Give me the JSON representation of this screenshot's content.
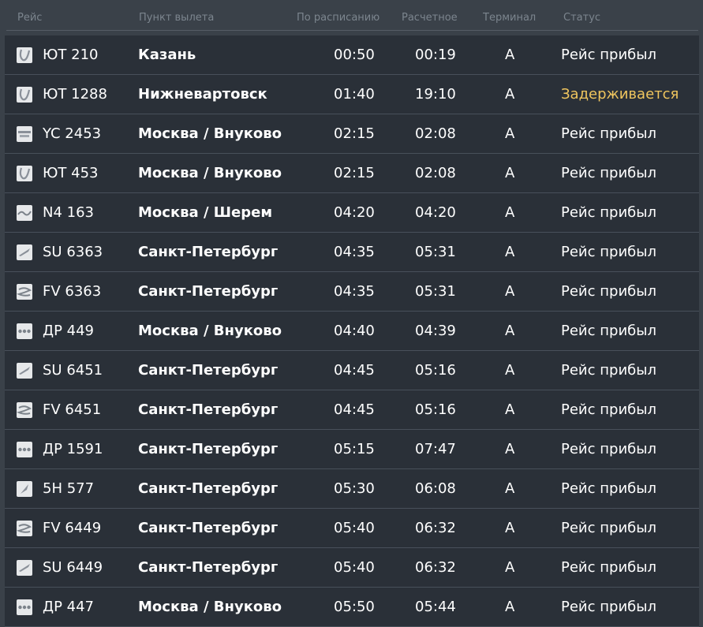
{
  "columns": {
    "flight": "Рейс",
    "origin": "Пункт вылета",
    "scheduled": "По расписанию",
    "estimated": "Расчетное",
    "terminal": "Терминал",
    "status": "Статус"
  },
  "colors": {
    "background": "#3a4149",
    "row": "#2a3038",
    "header_text": "#7c858e",
    "text": "#ffffff",
    "delayed": "#efc55e"
  },
  "flights": [
    {
      "logo": "utair-logo-icon",
      "flight": "ЮТ 210",
      "origin": "Казань",
      "scheduled": "00:50",
      "estimated": "00:19",
      "terminal": "A",
      "status": "Рейс прибыл",
      "delayed": false
    },
    {
      "logo": "utair-logo-icon",
      "flight": "ЮТ 1288",
      "origin": "Нижневартовск",
      "scheduled": "01:40",
      "estimated": "19:10",
      "terminal": "A",
      "status": "Задерживается",
      "delayed": true
    },
    {
      "logo": "yc-logo-icon",
      "flight": "YC 2453",
      "origin": "Москва / Внуково",
      "scheduled": "02:15",
      "estimated": "02:08",
      "terminal": "A",
      "status": "Рейс прибыл",
      "delayed": false
    },
    {
      "logo": "utair-logo-icon",
      "flight": "ЮТ 453",
      "origin": "Москва / Внуково",
      "scheduled": "02:15",
      "estimated": "02:08",
      "terminal": "A",
      "status": "Рейс прибыл",
      "delayed": false
    },
    {
      "logo": "nordwind-logo-icon",
      "flight": "N4 163",
      "origin": "Москва / Шерем",
      "scheduled": "04:20",
      "estimated": "04:20",
      "terminal": "A",
      "status": "Рейс прибыл",
      "delayed": false
    },
    {
      "logo": "aeroflot-logo-icon",
      "flight": "SU 6363",
      "origin": "Санкт-Петербург",
      "scheduled": "04:35",
      "estimated": "05:31",
      "terminal": "A",
      "status": "Рейс прибыл",
      "delayed": false
    },
    {
      "logo": "rossiya-logo-icon",
      "flight": "FV 6363",
      "origin": "Санкт-Петербург",
      "scheduled": "04:35",
      "estimated": "05:31",
      "terminal": "A",
      "status": "Рейс прибыл",
      "delayed": false
    },
    {
      "logo": "dobrolet-logo-icon",
      "flight": "ДР 449",
      "origin": "Москва / Внуково",
      "scheduled": "04:40",
      "estimated": "04:39",
      "terminal": "A",
      "status": "Рейс прибыл",
      "delayed": false
    },
    {
      "logo": "aeroflot-logo-icon",
      "flight": "SU 6451",
      "origin": "Санкт-Петербург",
      "scheduled": "04:45",
      "estimated": "05:16",
      "terminal": "A",
      "status": "Рейс прибыл",
      "delayed": false
    },
    {
      "logo": "rossiya-logo-icon",
      "flight": "FV 6451",
      "origin": "Санкт-Петербург",
      "scheduled": "04:45",
      "estimated": "05:16",
      "terminal": "A",
      "status": "Рейс прибыл",
      "delayed": false
    },
    {
      "logo": "dobrolet-logo-icon",
      "flight": "ДР 1591",
      "origin": "Санкт-Петербург",
      "scheduled": "05:15",
      "estimated": "07:47",
      "terminal": "A",
      "status": "Рейс прибыл",
      "delayed": false
    },
    {
      "logo": "5h-logo-icon",
      "flight": "5Н 577",
      "origin": "Санкт-Петербург",
      "scheduled": "05:30",
      "estimated": "06:08",
      "terminal": "A",
      "status": "Рейс прибыл",
      "delayed": false
    },
    {
      "logo": "rossiya-logo-icon",
      "flight": "FV 6449",
      "origin": "Санкт-Петербург",
      "scheduled": "05:40",
      "estimated": "06:32",
      "terminal": "A",
      "status": "Рейс прибыл",
      "delayed": false
    },
    {
      "logo": "aeroflot-logo-icon",
      "flight": "SU 6449",
      "origin": "Санкт-Петербург",
      "scheduled": "05:40",
      "estimated": "06:32",
      "terminal": "A",
      "status": "Рейс прибыл",
      "delayed": false
    },
    {
      "logo": "dobrolet-logo-icon",
      "flight": "ДР 447",
      "origin": "Москва / Внуково",
      "scheduled": "05:50",
      "estimated": "05:44",
      "terminal": "A",
      "status": "Рейс прибыл",
      "delayed": false
    }
  ]
}
